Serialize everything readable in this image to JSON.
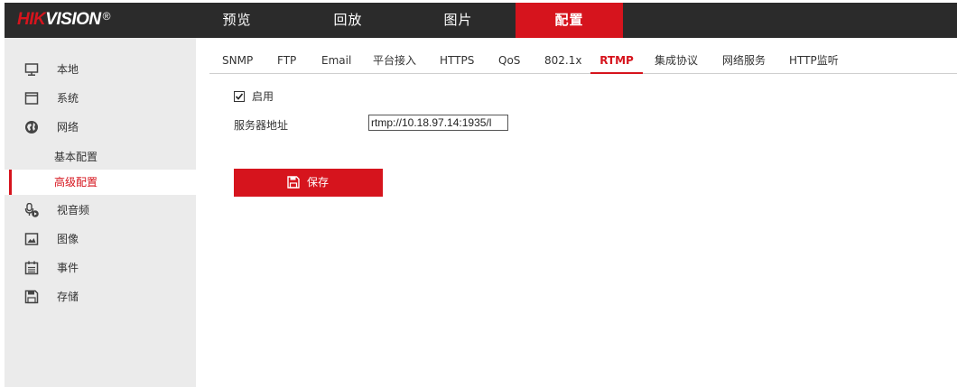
{
  "brand": {
    "hik": "HIK",
    "vision": "VISION",
    "reg": "®"
  },
  "nav": [
    {
      "label": "预览"
    },
    {
      "label": "回放"
    },
    {
      "label": "图片"
    },
    {
      "label": "配置"
    }
  ],
  "sidebar": {
    "items": [
      {
        "label": "本地",
        "icon": "monitor-icon"
      },
      {
        "label": "系统",
        "icon": "window-icon"
      },
      {
        "label": "网络",
        "icon": "globe-icon"
      },
      {
        "label": "视音频",
        "icon": "microphone-camera-icon"
      },
      {
        "label": "图像",
        "icon": "image-icon"
      },
      {
        "label": "事件",
        "icon": "calendar-icon"
      },
      {
        "label": "存储",
        "icon": "floppy-disk-icon"
      }
    ],
    "network_sub": [
      {
        "label": "基本配置"
      },
      {
        "label": "高级配置"
      }
    ]
  },
  "tabs": [
    {
      "label": "SNMP"
    },
    {
      "label": "FTP"
    },
    {
      "label": "Email"
    },
    {
      "label": "平台接入"
    },
    {
      "label": "HTTPS"
    },
    {
      "label": "QoS"
    },
    {
      "label": "802.1x"
    },
    {
      "label": "RTMP"
    },
    {
      "label": "集成协议"
    },
    {
      "label": "网络服务"
    },
    {
      "label": "HTTP监听"
    }
  ],
  "form": {
    "enable_label": "启用",
    "enabled": true,
    "server_label": "服务器地址",
    "server_value": "rtmp://10.18.97.14:1935/l"
  },
  "save_label": "保存",
  "colors": {
    "accent": "#d6141d",
    "topbar": "#2b2b2b",
    "sidebar": "#ebebeb"
  }
}
